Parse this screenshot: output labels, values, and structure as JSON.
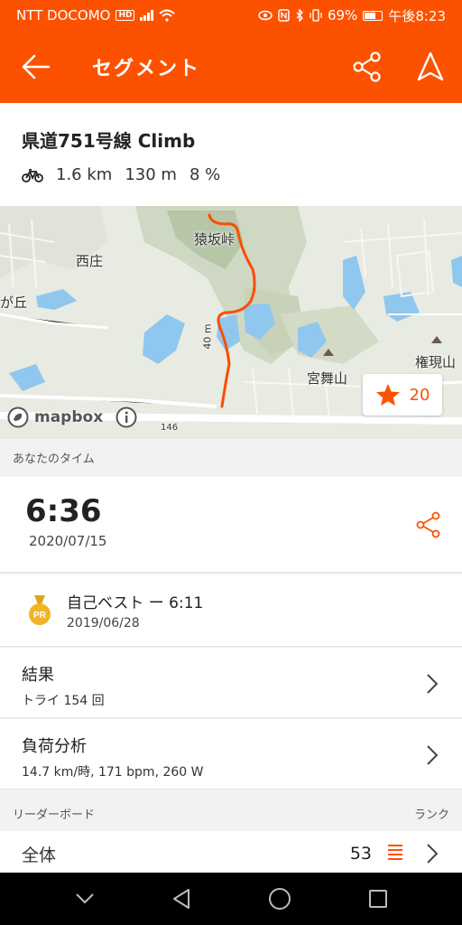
{
  "status_bar": {
    "carrier": "NTT DOCOMO",
    "hd_badge": "HD",
    "battery": "69%",
    "time": "午後8:23"
  },
  "app_bar": {
    "title": "セグメント",
    "icons": [
      "back-arrow-icon",
      "share-icon",
      "navigate-icon"
    ]
  },
  "segment": {
    "name": "県道751号線 Climb",
    "distance": "1.6 km",
    "elevation": "130 m",
    "grade": "8 %"
  },
  "map": {
    "labels": {
      "nishisho": "西庄",
      "sarusaka": "猿坂峠",
      "gaoka": "が丘",
      "miyamai": "宮舞山",
      "gongen": "権現山",
      "elev": "40 m",
      "road": "146"
    },
    "attribution": "mapbox",
    "star_count": "20"
  },
  "your_time": {
    "section_label": "あなたのタイム",
    "time": "6:36",
    "date": "2020/07/15"
  },
  "personal_best": {
    "badge": "PR",
    "label": "自己ベスト ー 6:11",
    "date": "2019/06/28"
  },
  "results": {
    "title": "結果",
    "subtitle": "トライ 154 回"
  },
  "effort_analysis": {
    "title": "負荷分析",
    "subtitle": "14.7 km/時, 171 bpm, 260 W"
  },
  "leaderboard": {
    "section_label": "リーダーボード",
    "rank_label": "ランク",
    "overall_label": "全体",
    "overall_rank": "53"
  },
  "colors": {
    "accent": "#fc5200"
  }
}
